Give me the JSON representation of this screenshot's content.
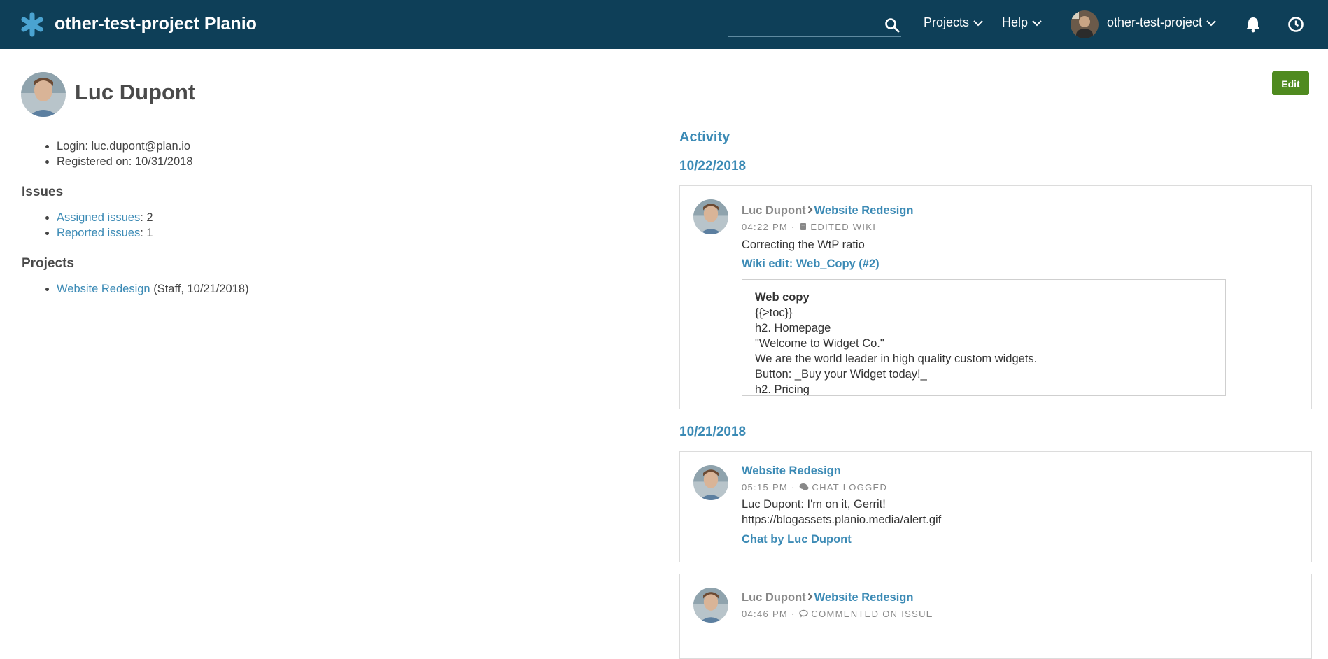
{
  "header": {
    "app_title": "other-test-project Planio",
    "search": {
      "value": "",
      "placeholder": ""
    },
    "nav": {
      "projects": "Projects",
      "help": "Help",
      "user": "other-test-project"
    },
    "colors": {
      "bar": "#0e3f58",
      "logo": "#4aa3d1"
    }
  },
  "profile": {
    "name": "Luc Dupont",
    "edit_label": "Edit",
    "login_label": "Login: ",
    "login_value": "luc.dupont@plan.io",
    "registered_label": "Registered on: ",
    "registered_value": "10/31/2018",
    "issues_heading": "Issues",
    "assigned_link": "Assigned issues",
    "assigned_count": ": 2",
    "reported_link": "Reported issues",
    "reported_count": ": 1",
    "projects_heading": "Projects",
    "project_link": "Website Redesign",
    "project_detail": " (Staff, 10/21/2018)"
  },
  "activity": {
    "title": "Activity",
    "dates": [
      "10/22/2018",
      "10/21/2018"
    ],
    "events": [
      {
        "author": "Luc Dupont",
        "project": "Website Redesign",
        "time": "04:22 PM",
        "action": "EDITED WIKI",
        "action_icon": "book-icon",
        "text": "Correcting the WtP ratio",
        "link": "Wiki edit: Web_Copy (#2)",
        "wiki": {
          "title": "Web copy",
          "lines": [
            "{{>toc}}",
            "h2. Homepage",
            "\"Welcome to Widget Co.\"",
            "We are the world leader in high quality custom widgets.",
            "Button: _Buy your Widget today!_",
            "h2. Pricing"
          ]
        }
      },
      {
        "project": "Website Redesign",
        "time": "05:15 PM",
        "action": "CHAT LOGGED",
        "action_icon": "chat-icon",
        "text_lines": [
          "Luc Dupont: I'm on it, Gerrit!",
          "https://blogassets.planio.media/alert.gif"
        ],
        "link": "Chat by Luc Dupont"
      },
      {
        "author": "Luc Dupont",
        "project": "Website Redesign",
        "time": "04:46 PM",
        "action": "COMMENTED ON ISSUE",
        "action_icon": "comment-icon"
      }
    ]
  }
}
